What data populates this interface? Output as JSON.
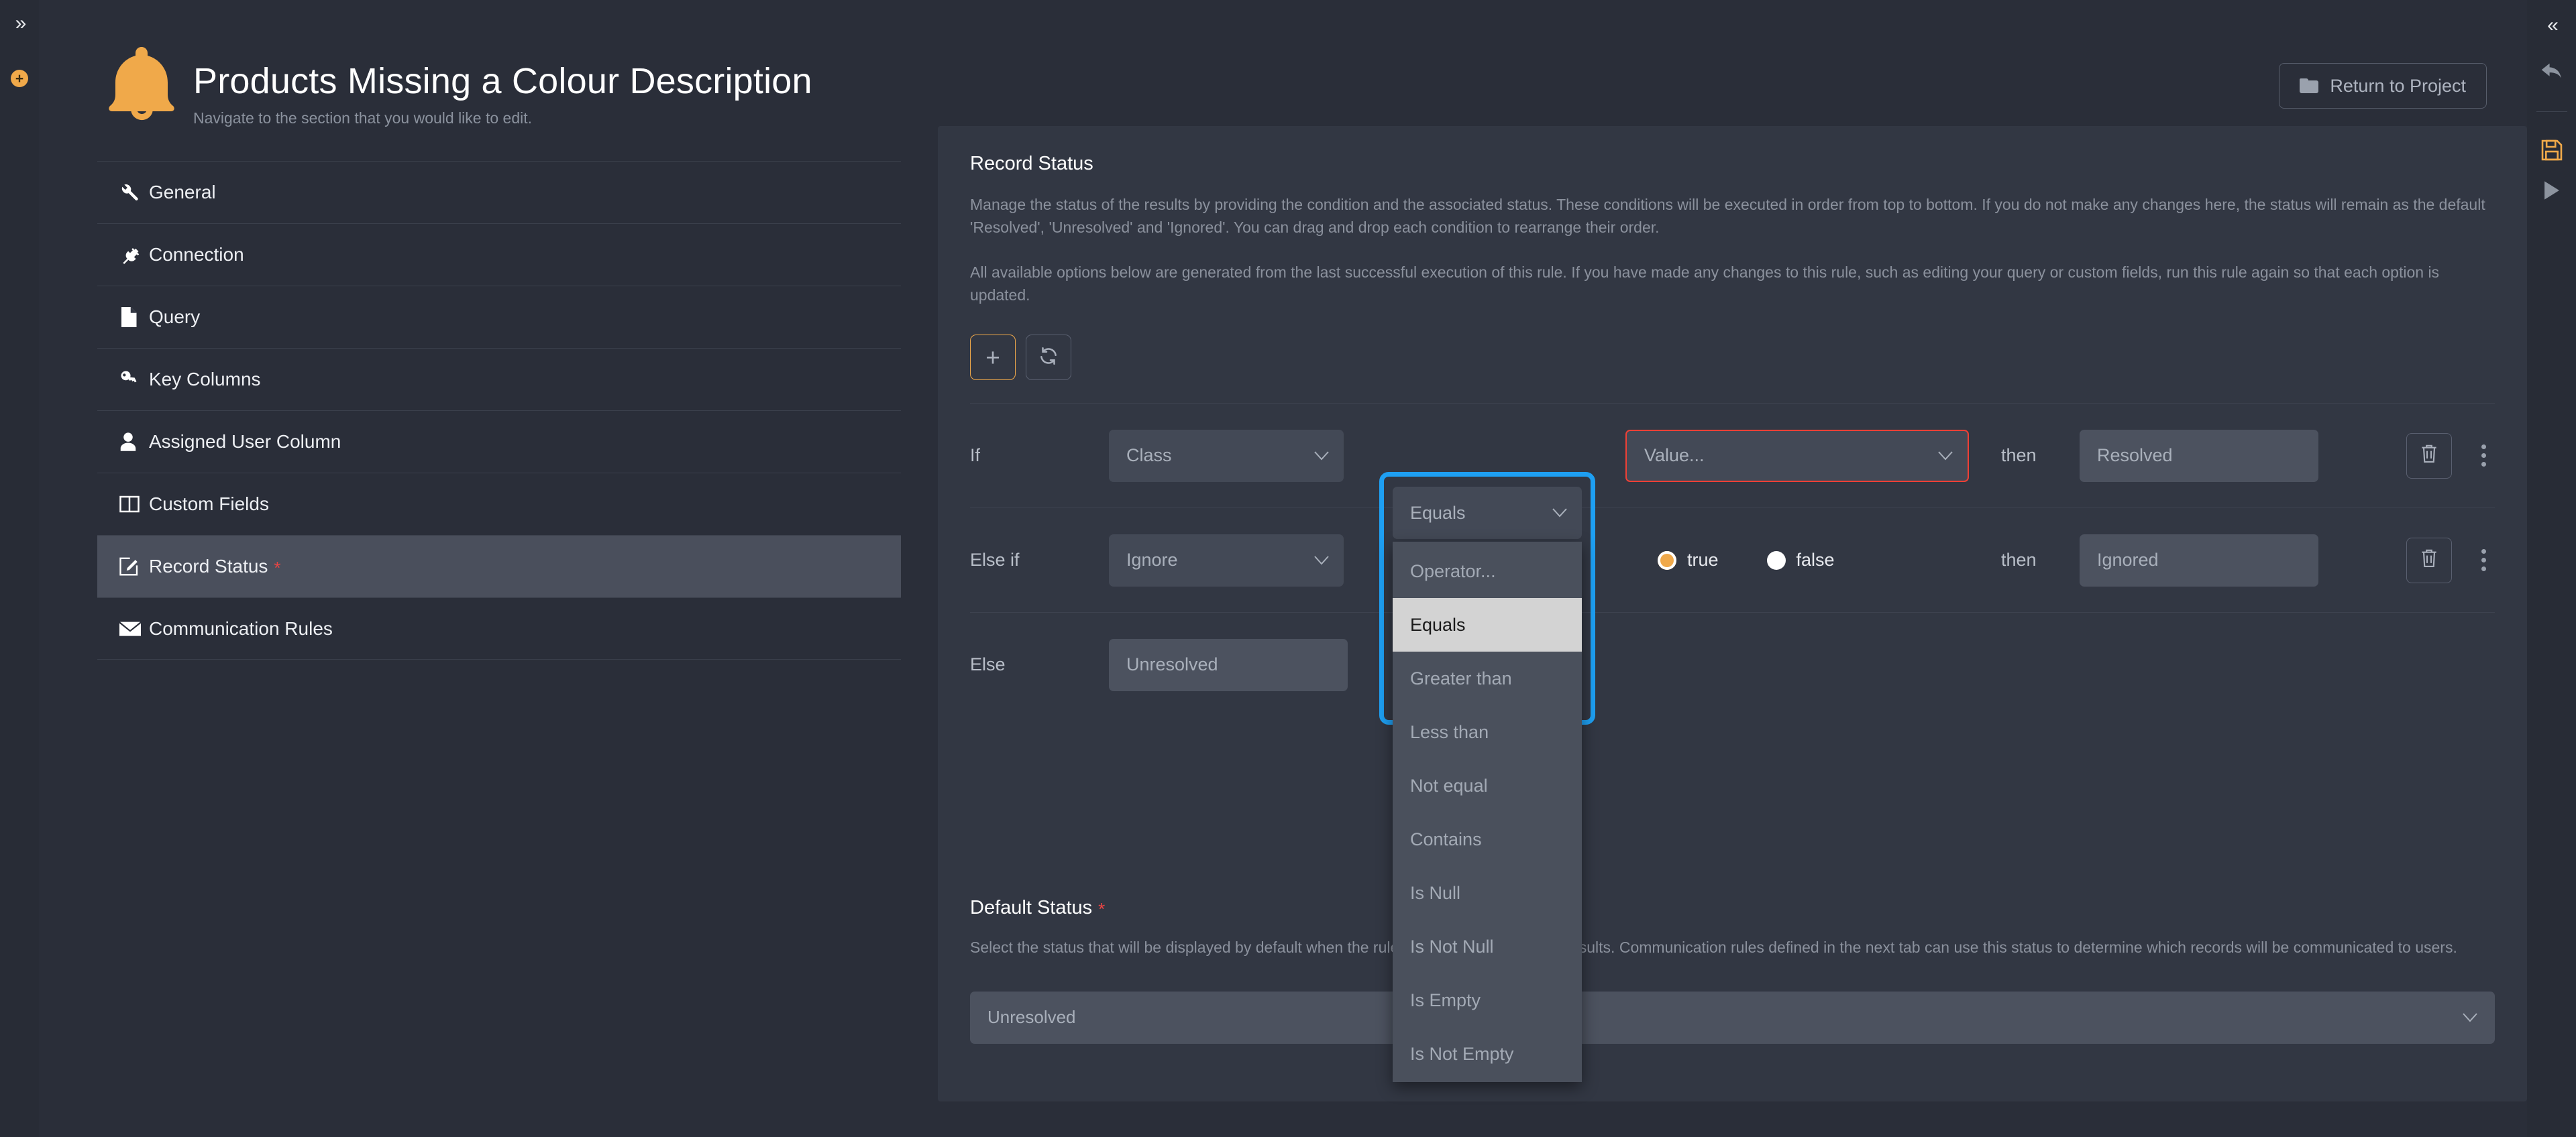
{
  "left_rail": {
    "expand_icon": "double-chevron-right-icon",
    "add_icon": "plus-circle-icon"
  },
  "header": {
    "logo_icon": "bell-icon",
    "title": "Products Missing a Colour Description",
    "subtitle": "Navigate to the section that you would like to edit.",
    "return_button": {
      "label": "Return to Project",
      "icon": "folder-icon"
    }
  },
  "sidebar": {
    "items": [
      {
        "label": "General",
        "icon": "wrench-icon",
        "active": false,
        "required": false
      },
      {
        "label": "Connection",
        "icon": "plug-icon",
        "active": false,
        "required": false
      },
      {
        "label": "Query",
        "icon": "file-icon",
        "active": false,
        "required": false
      },
      {
        "label": "Key Columns",
        "icon": "key-icon",
        "active": false,
        "required": false
      },
      {
        "label": "Assigned User Column",
        "icon": "user-icon",
        "active": false,
        "required": false
      },
      {
        "label": "Custom Fields",
        "icon": "columns-icon",
        "active": false,
        "required": false
      },
      {
        "label": "Record Status",
        "icon": "edit-icon",
        "active": true,
        "required": true
      },
      {
        "label": "Communication Rules",
        "icon": "envelope-icon",
        "active": false,
        "required": false
      }
    ],
    "required_marker": "*"
  },
  "record_status": {
    "title": "Record Status",
    "paragraph_1": "Manage the status of the results by providing the condition and the associated status. These conditions will be executed in order from top to bottom. If you do not make any changes here, the status will remain as the default 'Resolved', 'Unresolved' and 'Ignored'. You can drag and drop each condition to rearrange their order.",
    "paragraph_2": "All available options below are generated from the last successful execution of this rule. If you have made any changes to this rule, such as editing your query or custom fields, run this rule again so that each option is updated.",
    "toolbar": {
      "add_label": "+",
      "add_icon": "plus-icon",
      "refresh_icon": "refresh-icon"
    },
    "rows": [
      {
        "keyword": "If",
        "field": "Class",
        "operator": "Equals",
        "value_placeholder": "Value...",
        "then_label": "then",
        "status": "Resolved",
        "delete_icon": "trash-icon",
        "menu_icon": "kebab-menu-icon",
        "value_invalid": true
      },
      {
        "keyword": "Else if",
        "field": "Ignore",
        "bool_options": [
          {
            "label": "true",
            "selected": true
          },
          {
            "label": "false",
            "selected": false
          }
        ],
        "then_label": "then",
        "status": "Ignored",
        "delete_icon": "trash-icon",
        "menu_icon": "kebab-menu-icon"
      }
    ],
    "else_row": {
      "keyword": "Else",
      "status": "Unresolved"
    }
  },
  "operator_dropdown": {
    "open": true,
    "selected_value": "Equals",
    "highlight_color": "#1e9ff2",
    "options": [
      {
        "label": "Operator...",
        "selected": false
      },
      {
        "label": "Equals",
        "selected": true
      },
      {
        "label": "Greater than",
        "selected": false
      },
      {
        "label": "Less than",
        "selected": false
      },
      {
        "label": "Not equal",
        "selected": false
      },
      {
        "label": "Contains",
        "selected": false
      },
      {
        "label": "Is Null",
        "selected": false
      },
      {
        "label": "Is Not Null",
        "selected": false
      },
      {
        "label": "Is Empty",
        "selected": false
      },
      {
        "label": "Is Not Empty",
        "selected": false
      }
    ]
  },
  "default_status": {
    "title": "Default Status",
    "required_marker": "*",
    "description": "Select the status that will be displayed by default when the rule is executed against the results. Communication rules defined in the next tab can use this status to determine which records will be communicated to users.",
    "selected": "Unresolved"
  },
  "right_toolbar": {
    "collapse_icon": "double-chevron-left-icon",
    "undo_icon": "undo-arrow-icon",
    "save_icon": "save-floppy-icon",
    "run_icon": "play-icon",
    "save_color": "#f0a94a"
  },
  "colors": {
    "page_bg": "#2a2e39",
    "panel_bg": "#323743",
    "accent": "#f0a94a",
    "error": "#ef4036",
    "highlight": "#1e9ff2"
  }
}
